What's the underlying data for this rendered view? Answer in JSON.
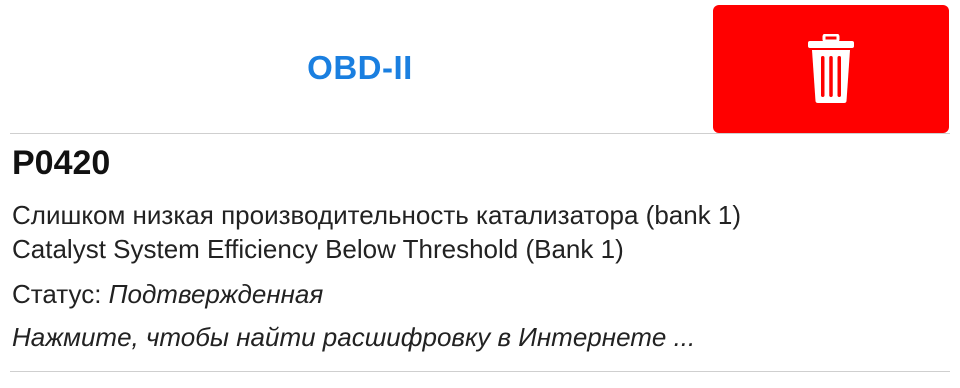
{
  "header": {
    "tab_label": "OBD-II",
    "delete_icon": "trash-icon"
  },
  "dtc": {
    "code": "P0420",
    "description_ru": "Слишком низкая производительность катализатора (bank 1)",
    "description_en": "Catalyst System Efficiency Below Threshold (Bank 1)",
    "status_label": "Статус: ",
    "status_value": "Подтвержденная",
    "search_link": "Нажмите, чтобы найти расшифровку в Интернете ..."
  },
  "colors": {
    "accent_blue": "#1a7fe0",
    "delete_red": "#ff0000",
    "divider": "#cfcfcf"
  }
}
